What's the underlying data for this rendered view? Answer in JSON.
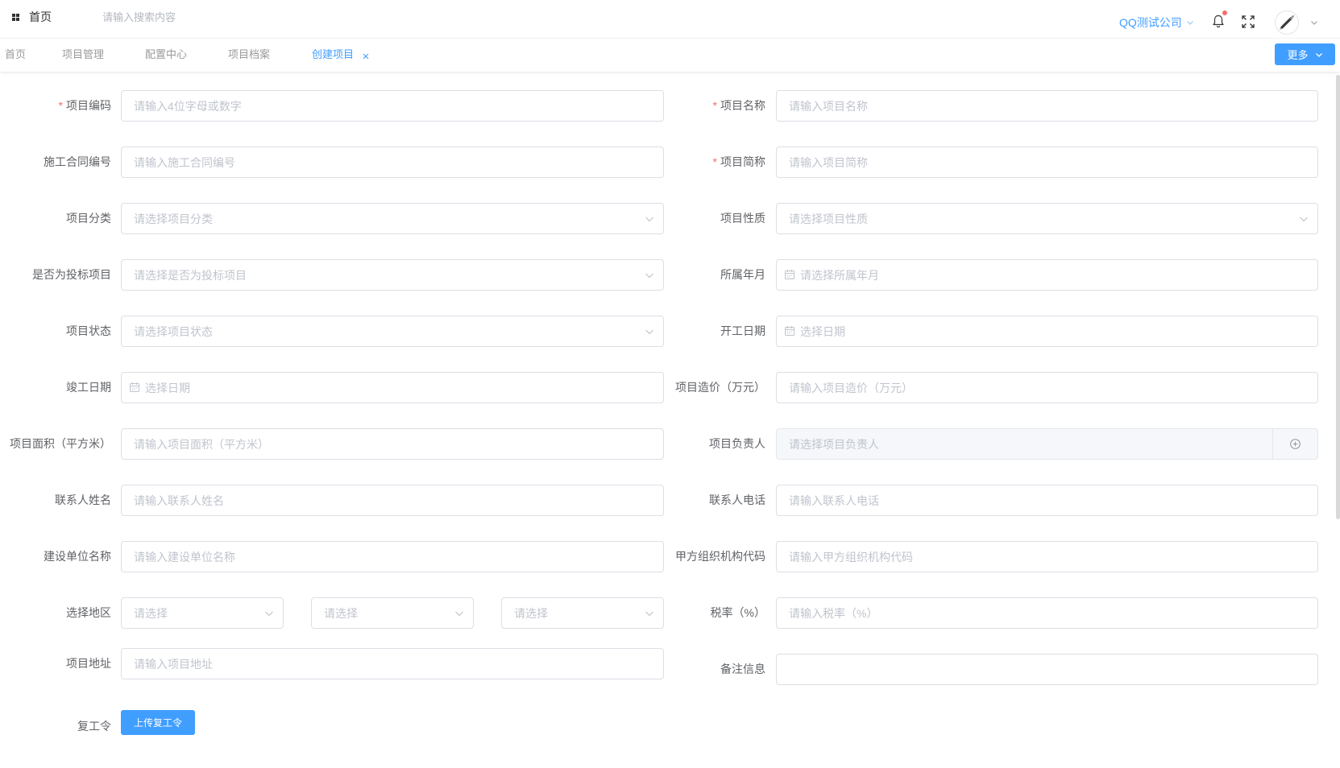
{
  "header": {
    "home_label": "首页",
    "search_placeholder": "请输入搜索内容",
    "search_value": "",
    "company_name": "QQ测试公司",
    "has_notification": true
  },
  "tabs": [
    {
      "label": "首页",
      "active": false
    },
    {
      "label": "项目管理",
      "active": false
    },
    {
      "label": "配置中心",
      "active": false
    },
    {
      "label": "项目档案",
      "active": false
    },
    {
      "label": "创建项目",
      "active": true,
      "closable": true
    }
  ],
  "more_button_label": "更多",
  "form": {
    "required_mark": "*",
    "left": [
      {
        "label": "项目编码",
        "placeholder": "请输入4位字母或数字",
        "value": "",
        "required": true
      },
      {
        "label": "施工合同编号",
        "placeholder": "请输入施工合同编号",
        "value": ""
      },
      {
        "label": "项目分类",
        "placeholder": "请选择项目分类",
        "value": "",
        "icon": "chevron-down-icon"
      },
      {
        "label": "是否为投标项目",
        "placeholder": "请选择是否为投标项目",
        "value": "",
        "icon": "chevron-down-icon"
      },
      {
        "label": "项目状态",
        "placeholder": "请选择项目状态",
        "value": "",
        "icon": "chevron-down-icon"
      },
      {
        "label": "竣工日期",
        "placeholder": "选择日期",
        "value": "",
        "icon": "calendar-icon"
      },
      {
        "label": "项目面积（平方米）",
        "placeholder": "请输入项目面积（平方米）",
        "value": ""
      },
      {
        "label": "联系人姓名",
        "placeholder": "请输入联系人姓名",
        "value": ""
      },
      {
        "label": "建设单位名称",
        "placeholder": "请输入建设单位名称",
        "value": ""
      },
      {
        "label": "选择地区",
        "selects": [
          {
            "placeholder": "请选择",
            "value": "",
            "icon": "chevron-down-icon"
          },
          {
            "placeholder": "请选择",
            "value": "",
            "icon": "chevron-down-icon"
          },
          {
            "placeholder": "请选择",
            "value": "",
            "icon": "chevron-down-icon"
          }
        ]
      },
      {
        "label": "项目地址",
        "placeholder": "请输入项目地址",
        "value": ""
      }
    ],
    "right": [
      {
        "label": "项目名称",
        "placeholder": "请输入项目名称",
        "value": "",
        "required": true
      },
      {
        "label": "项目简称",
        "placeholder": "请输入项目简称",
        "value": "",
        "required": true
      },
      {
        "label": "项目性质",
        "placeholder": "请选择项目性质",
        "value": "",
        "icon": "chevron-down-icon"
      },
      {
        "label": "所属年月",
        "placeholder": "请选择所属年月",
        "value": "",
        "icon": "calendar-icon"
      },
      {
        "label": "开工日期",
        "placeholder": "选择日期",
        "value": "",
        "icon": "calendar-icon"
      },
      {
        "label": "项目造价（万元）",
        "placeholder": "请输入项目造价（万元）",
        "value": ""
      },
      {
        "label": "项目负责人",
        "placeholder": "请选择项目负责人",
        "value": "",
        "disabled": true,
        "icon": "circle-plus-icon"
      },
      {
        "label": "联系人电话",
        "placeholder": "请输入联系人电话",
        "value": ""
      },
      {
        "label": "甲方组织机构代码",
        "placeholder": "请输入甲方组织机构代码",
        "value": ""
      },
      {
        "label": "税率（%）",
        "placeholder": "请输入税率（%）",
        "value": ""
      },
      {
        "label": "备注信息",
        "placeholder": "",
        "value": ""
      }
    ]
  },
  "upload": {
    "label": "复工令",
    "button_label": "上传复工令"
  },
  "colors": {
    "accent": "#409eff",
    "required": "#f56c6c",
    "label_text": "#606266",
    "placeholder": "#c0c4cc",
    "border": "#dcdfe6",
    "disabled_bg": "#f5f7fa",
    "tab_text": "#9a9a9a",
    "notification_dot": "#f56c6c"
  }
}
